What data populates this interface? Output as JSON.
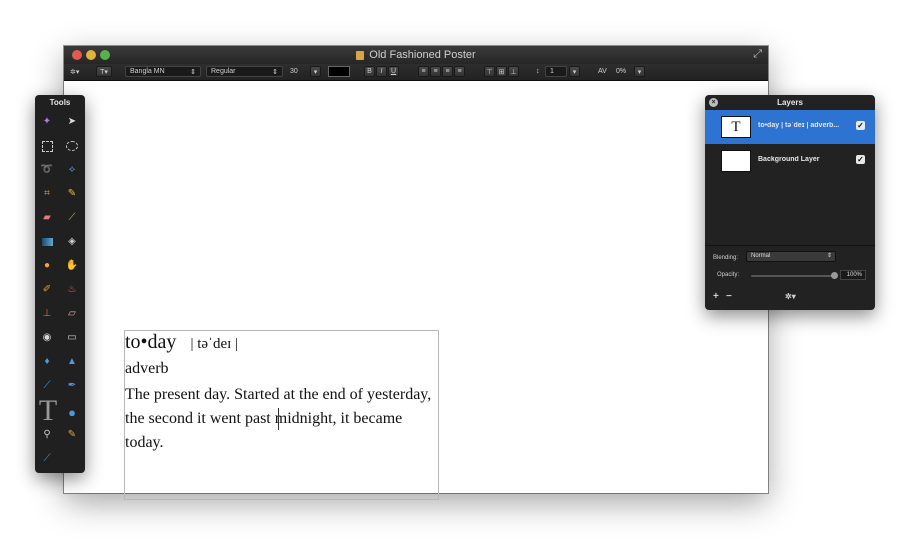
{
  "window": {
    "title": "Old Fashioned Poster"
  },
  "toolbar": {
    "gear": "✲▾",
    "text_tool": "T▾",
    "font_family": "Bangla MN",
    "font_style": "Regular",
    "font_size": "30",
    "bold": "B",
    "italic": "I",
    "underline": "U",
    "line_spacing": "1",
    "tracking_label": "AV",
    "tracking_value": "0%",
    "text_color": "#000000"
  },
  "document": {
    "headword": "to•day",
    "pronunciation": "| təˈdeɪ |",
    "part_of_speech": "adverb",
    "definition": "The present day. Started at the end of yesterday, the second it went past midnight, it became today."
  },
  "tools": {
    "title": "Tools",
    "items": [
      "magic-wand",
      "move-selection",
      "rect-select",
      "ellipse-select",
      "lasso",
      "polygon-lasso",
      "crop",
      "color-picker",
      "eraser",
      "pencil",
      "gradient",
      "paint-bucket",
      "smudge",
      "clone",
      "brush",
      "burn",
      "stamp",
      "bandage",
      "red-eye",
      "blur",
      "sharpen",
      "dodge",
      "pen",
      "vector-pen",
      "type",
      "shape",
      "zoom",
      "eyedropper",
      "line"
    ]
  },
  "layers": {
    "title": "Layers",
    "items": [
      {
        "name": "to•day | təˈdeɪ | adverb...",
        "thumb": "T",
        "visible": true,
        "selected": true
      },
      {
        "name": "Background Layer",
        "thumb": "",
        "visible": true,
        "selected": false
      }
    ],
    "blending_label": "Blending:",
    "blending_value": "Normal",
    "opacity_label": "Opacity:",
    "opacity_value": "100%",
    "opacity_level": 1.0,
    "add": "+",
    "remove": "−",
    "gear": "✲▾"
  },
  "colors": {
    "selection": "#2c73d2",
    "panel_bg": "#222222",
    "close": "#e25a4f",
    "minimize": "#e0b23a",
    "maximize": "#5ab04a"
  }
}
